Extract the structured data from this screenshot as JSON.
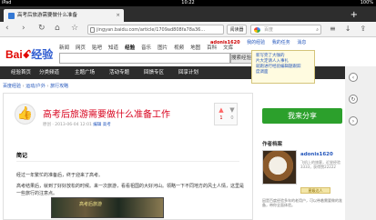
{
  "statusbar": {
    "device": "iPad",
    "time": "10:22",
    "right": "100%"
  },
  "tab": {
    "title": "高考后旅游需要做什么准备",
    "close": "×"
  },
  "toolbar": {
    "url": "jingyan.baidu.com/article/1709ad808fa78a36…",
    "read_label": "阅读器",
    "search_placeholder": "百度",
    "icons": {
      "back": "back-icon",
      "forward": "forward-icon",
      "reload": "reload-icon",
      "home": "home-icon",
      "favorite": "star-icon"
    }
  },
  "header": {
    "logo_bai": "Bai",
    "logo_du": "du",
    "logo_jingyan": "经验",
    "nav": [
      "新闻",
      "网页",
      "贴吧",
      "知道",
      "经验",
      "音乐",
      "图片",
      "视频",
      "地图",
      "百科",
      "文库"
    ],
    "search_button": "搜索经验",
    "user": "adonis1620",
    "user_links": [
      "我的经验",
      "我的任务",
      "消息"
    ]
  },
  "dropdown": {
    "lines": [
      "新写完了大咖的",
      "片大定请人入事扎",
      "",
      "就跑进行经验编辑题跟踪",
      "度调面"
    ]
  },
  "catbar": {
    "items": [
      "经验首页",
      "分类频道",
      "主题广场",
      "活动专题",
      "回馈专区",
      "回享计划"
    ]
  },
  "breadcrumb": {
    "items": [
      "百度经验",
      "运动/户外",
      "旅行攻略"
    ]
  },
  "article": {
    "thumb_icon": "thumbs-up-icon",
    "title": "高考后旅游需要做什么准备工作",
    "meta": "原创 · 2013-06-04 12:01",
    "meta_edit": "编辑",
    "meta_category": "高考",
    "vote_up": "1",
    "vote_down": "0",
    "section": "简记",
    "paragraphs": [
      "经过一年繁忙的准备后，终于迎来了高考。",
      "高考结果后，就到了好好放松的时候。来一次旅游，看看祖国的大好河山。领略一下不同地方的风土人情，这里是一些旅行的注意点。"
    ],
    "image_caption": "高考后旅游"
  },
  "sidepanel": {
    "share_label": "我来分享",
    "author_heading": "作者档案",
    "author_name": "adonis1620",
    "author_info": "飞机上的旅客，近尝经验3333，获得赞22222",
    "badge": "星级达人",
    "bio": "因是百度经验多年的老用户，可以带着需要做的准备，带你全面体验。"
  }
}
